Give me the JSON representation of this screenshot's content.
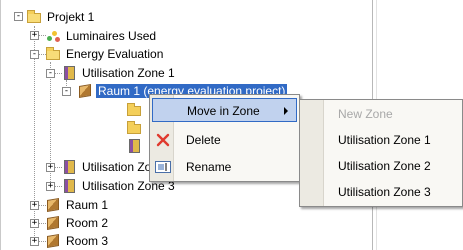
{
  "tree": {
    "root": {
      "label": "Projekt 1",
      "expander": "-"
    },
    "luminaires": {
      "label": "Luminaires Used",
      "expander": "+"
    },
    "energy": {
      "label": "Energy Evaluation",
      "expander": "-"
    },
    "zone1": {
      "label": "Utilisation Zone 1",
      "expander": "-"
    },
    "raum1_selected": {
      "label": "Raum 1 (energy evaluation project)",
      "expander": "-"
    },
    "zone2": {
      "label": "Utilisation Zone 2",
      "expander": "+"
    },
    "zone3": {
      "label": "Utilisation Zone 3",
      "expander": "+"
    },
    "raum1": {
      "label": "Raum 1",
      "expander": "+"
    },
    "room2": {
      "label": "Room 2",
      "expander": "+"
    },
    "room3": {
      "label": "Room 3",
      "expander": "+"
    }
  },
  "context_menu": {
    "move_in_zone": "Move in Zone",
    "delete": "Delete",
    "rename": "Rename"
  },
  "submenu": {
    "new_zone": "New Zone",
    "zone1": "Utilisation Zone 1",
    "zone2": "Utilisation Zone 2",
    "zone3": "Utilisation Zone 3"
  },
  "colors": {
    "selection": "#316ac5",
    "menu_highlight": "#c1d2ee",
    "delete_icon": "#e03a2e"
  }
}
